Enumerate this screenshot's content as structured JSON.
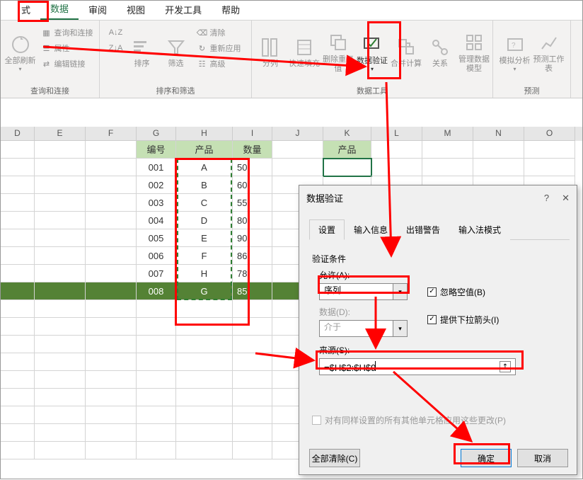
{
  "tabs": {
    "t0": "式",
    "t1": "数据",
    "t2": "审阅",
    "t3": "视图",
    "t4": "开发工具",
    "t5": "帮助"
  },
  "ribbon": {
    "refresh": "全部刷新",
    "queries": "查询和连接",
    "props": "属性",
    "editlinks": "编辑链接",
    "group1": "查询和连接",
    "sortaz": "排序",
    "filter": "筛选",
    "clear": "清除",
    "reapply": "重新应用",
    "advanced": "高级",
    "group2": "排序和筛选",
    "textcol": "分列",
    "flash": "快速填充",
    "removedup": "删除重复值",
    "datavalid": "数据验证",
    "consolidate": "合并计算",
    "relations": "关系",
    "datamodel": "管理数据模型",
    "group3": "数据工具",
    "whatif": "模拟分析",
    "forecast": "预测工作表",
    "group4": "预测"
  },
  "cols": [
    "D",
    "E",
    "F",
    "G",
    "H",
    "I",
    "J",
    "K",
    "L",
    "M",
    "N",
    "O"
  ],
  "table": {
    "headers": {
      "id": "编号",
      "prod": "产品",
      "qty": "数量"
    },
    "sideHeader": "产品",
    "rows": [
      {
        "id": "001",
        "prod": "A",
        "qty": "50"
      },
      {
        "id": "002",
        "prod": "B",
        "qty": "60"
      },
      {
        "id": "003",
        "prod": "C",
        "qty": "55"
      },
      {
        "id": "004",
        "prod": "D",
        "qty": "80"
      },
      {
        "id": "005",
        "prod": "E",
        "qty": "90"
      },
      {
        "id": "006",
        "prod": "F",
        "qty": "86"
      },
      {
        "id": "007",
        "prod": "H",
        "qty": "78"
      },
      {
        "id": "008",
        "prod": "G",
        "qty": "85"
      }
    ]
  },
  "dialog": {
    "title": "数据验证",
    "help": "?",
    "close": "✕",
    "tabs": {
      "t1": "设置",
      "t2": "输入信息",
      "t3": "出错警告",
      "t4": "输入法模式"
    },
    "critLabel": "验证条件",
    "allowLabel": "允许(A):",
    "allowValue": "序列",
    "ignoreBlank": "忽略空值(B)",
    "dropdown": "提供下拉箭头(I)",
    "dataLabel": "数据(D):",
    "dataValue": "介于",
    "sourceLabel": "来源(S):",
    "sourceValue": "=$H$2:$H$9",
    "applyAll": "对有同样设置的所有其他单元格应用这些更改(P)",
    "clearAll": "全部清除(C)",
    "ok": "确定",
    "cancel": "取消"
  }
}
